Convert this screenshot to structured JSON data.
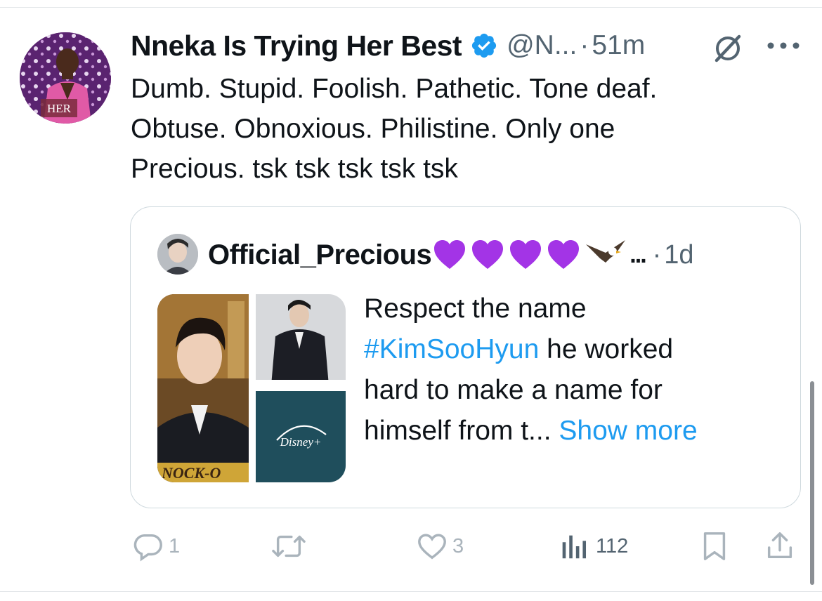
{
  "tweet": {
    "display_name": "Nneka Is Trying Her Best",
    "handle": "@N...",
    "separator": "·",
    "time": "51m",
    "avatar_caption": "HER",
    "text_lines": [
      "Dumb. Stupid. Foolish. Pathetic. Tone deaf.",
      "Obtuse. Obnoxious. Philistine. Only one",
      "Precious. tsk tsk tsk tsk tsk"
    ]
  },
  "quote": {
    "display_name": "Official_Precious",
    "emoji_icons": [
      "purple-heart-icon",
      "purple-heart-icon",
      "purple-heart-icon",
      "purple-heart-icon",
      "eagle-icon"
    ],
    "ellipsis": "...",
    "separator": "·",
    "time": "1d",
    "media_text": {
      "streaming_logo": "Disney+",
      "poster_fragment": "NOCK-O"
    },
    "text_line1": "Respect the name",
    "hashtag": "#KimSooHyun",
    "text_line2_rest": " he worked",
    "text_line3": "hard to make a name for",
    "text_line4": "himself from t...",
    "show_more": "Show more"
  },
  "actions": {
    "replies": "1",
    "reposts": "",
    "likes": "3",
    "views": "112"
  },
  "colors": {
    "link": "#1d9bf0",
    "muted": "#536471",
    "faded_action": "#aab4bc",
    "verified": "#1d9bf0",
    "heart": "#a334e6"
  }
}
